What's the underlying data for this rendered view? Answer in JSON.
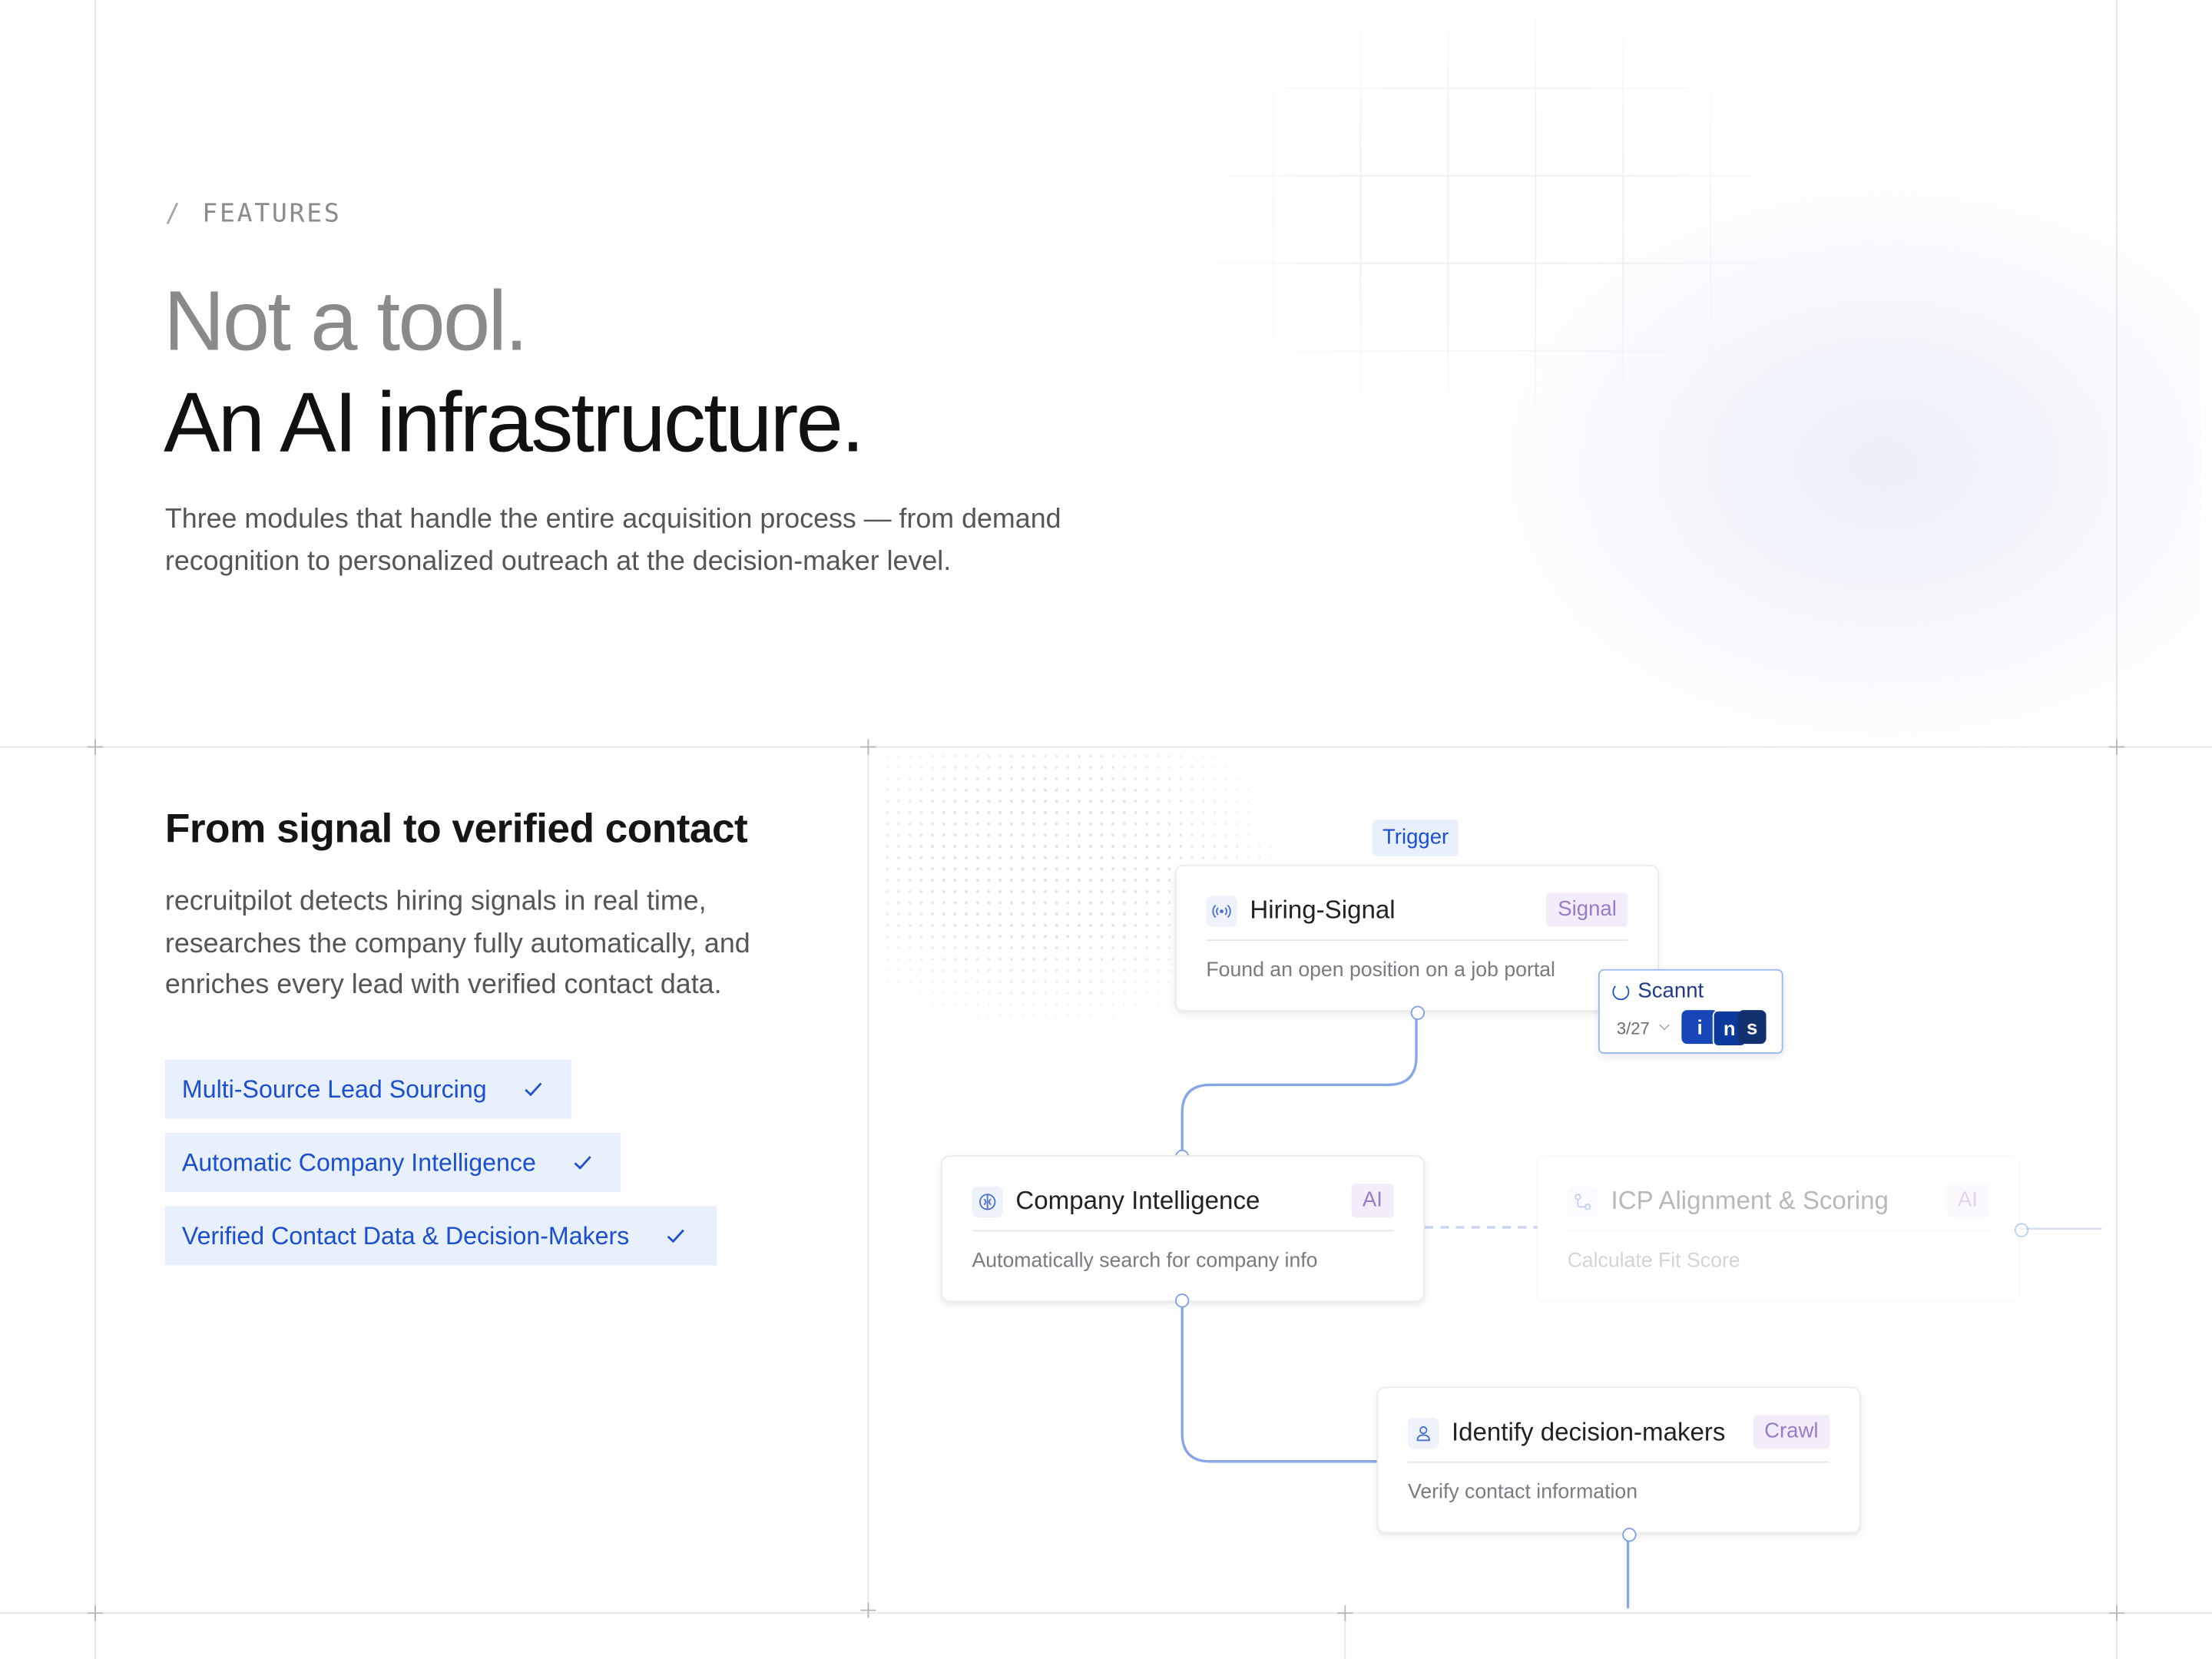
{
  "header": {
    "eyebrow_slash": "/",
    "eyebrow": "FEATURES",
    "headline_line1": "Not a tool.",
    "headline_line2": "An AI infrastructure.",
    "lead": "Three modules that handle the entire acquisition process — from demand recognition to personalized outreach at the decision-maker level."
  },
  "feature": {
    "title": "From signal to verified contact",
    "description": "recruitpilot detects hiring signals in real time, researches the company fully automatically, and enriches every lead with verified contact data.",
    "items": [
      {
        "label": "Multi-Source Lead Sourcing"
      },
      {
        "label": "Automatic Company Intelligence"
      },
      {
        "label": "Verified Contact Data & Decision-Makers"
      }
    ]
  },
  "workflow": {
    "trigger_label": "Trigger",
    "nodes": {
      "hiring_signal": {
        "title": "Hiring-Signal",
        "badge": "Signal",
        "subtitle": "Found an open position on a job portal",
        "icon": "broadcast-icon"
      },
      "company_intel": {
        "title": "Company Intelligence",
        "badge": "AI",
        "subtitle": "Automatically search for company info",
        "icon": "brain-icon"
      },
      "icp_scoring": {
        "title": "ICP Alignment & Scoring",
        "badge": "AI",
        "subtitle": "Calculate Fit Score",
        "icon": "scoring-icon"
      },
      "decision_makers": {
        "title": "Identify decision-makers",
        "badge": "Crawl",
        "subtitle": "Verify contact information",
        "icon": "user-icon"
      }
    },
    "scan_popup": {
      "label": "Scannt",
      "count": "3/27",
      "sources": [
        "i",
        "n",
        "s"
      ]
    }
  },
  "colors": {
    "accent": "#1a4fd0",
    "pill_bg": "#e9f0fd",
    "badge_bg": "#f3edfb",
    "badge_text": "#9a7ac9",
    "connector": "#7ea0e6",
    "grid_line": "#e6e6e8"
  }
}
